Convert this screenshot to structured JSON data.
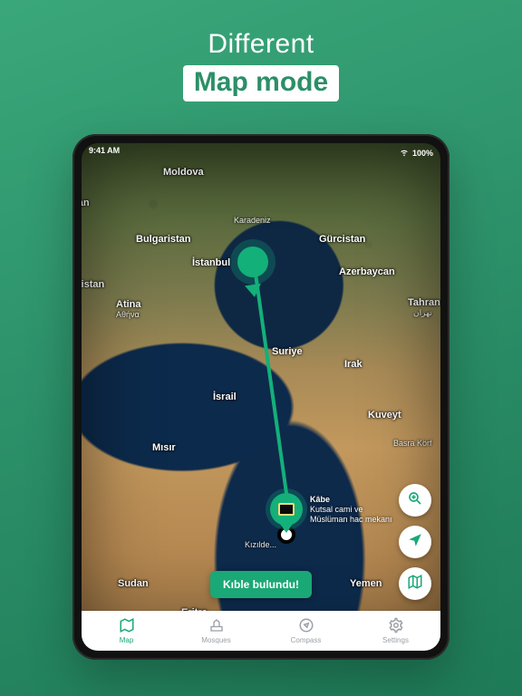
{
  "headline": {
    "line1": "Different",
    "line2": "Map mode"
  },
  "status": {
    "time": "9:41 AM",
    "battery": "100%"
  },
  "places": {
    "moldova": "Moldova",
    "karadeniz": "Karadeniz",
    "istanbul": "İstanbul",
    "bulgaristan": "Bulgaristan",
    "gurcistan": "Gürcistan",
    "azerbaycan": "Azerbaycan",
    "hanistan": "hanistan",
    "atina": "Atina",
    "atina_sub": "Αθήνα",
    "suriye": "Suriye",
    "irak": "Irak",
    "israil": "İsrail",
    "kuveyt": "Kuveyt",
    "misir": "Mısır",
    "basra": "Basra Körf",
    "tahran": "Tahran",
    "tahran_sub": "تهران",
    "sudan": "Sudan",
    "yemen": "Yemen",
    "eritre": "Eritre",
    "kizildeniz": "Kızılde...",
    "stan": "stan"
  },
  "kabe": {
    "title": "Kâbe",
    "subtitle": "Kutsal cami ve\nMüslüman hac mekanı"
  },
  "toast": "Kıble bulundu!",
  "tabs": {
    "map": "Map",
    "mosques": "Mosques",
    "compass": "Compass",
    "settings": "Settings"
  },
  "colors": {
    "accent": "#1aa877"
  }
}
